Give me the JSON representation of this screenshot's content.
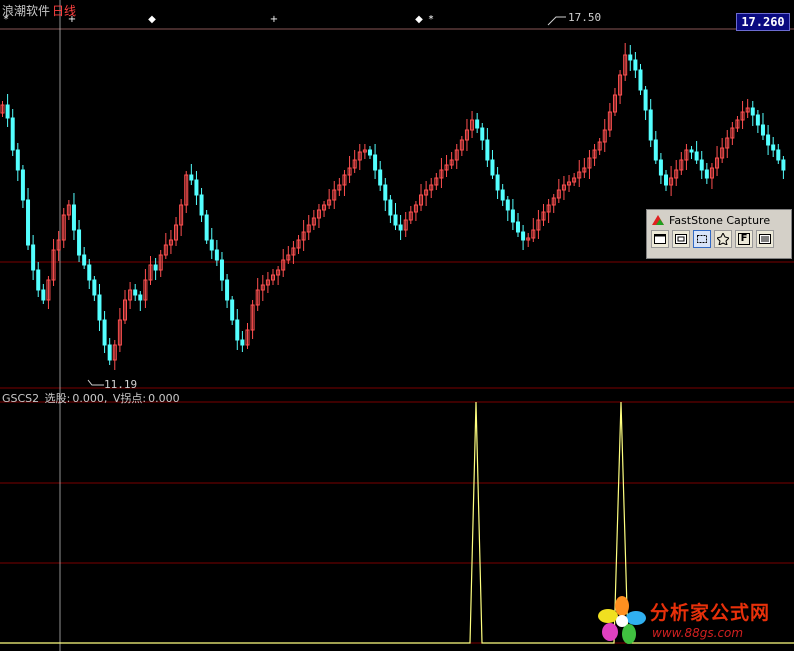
{
  "header": {
    "app_name": "浪潮软件",
    "period": "日线",
    "current_price": "17.260"
  },
  "price_chart": {
    "high_label": "17.50",
    "low_label": "11.19"
  },
  "indicator": {
    "name": "GSCS2",
    "field1_label": "选股:",
    "field1_value": "0.000,",
    "field2_label": "V拐点:",
    "field2_value": "0.000"
  },
  "colors": {
    "up": "#ff5050",
    "down": "#54ffff",
    "grid": "#7a0000",
    "indicator_line": "#ffff80"
  },
  "faststone": {
    "title": "FastStone Capture",
    "buttons": [
      {
        "icon": "window-icon",
        "label": ""
      },
      {
        "icon": "object-icon",
        "label": ""
      },
      {
        "icon": "rectangle-icon",
        "label": ""
      },
      {
        "icon": "freehand-icon",
        "label": ""
      },
      {
        "icon": "fullscreen-icon",
        "label": "F"
      },
      {
        "icon": "scrolling-icon",
        "label": ""
      }
    ]
  },
  "watermark": {
    "name": "分析家公式网",
    "url": "www.88gs.com"
  }
}
